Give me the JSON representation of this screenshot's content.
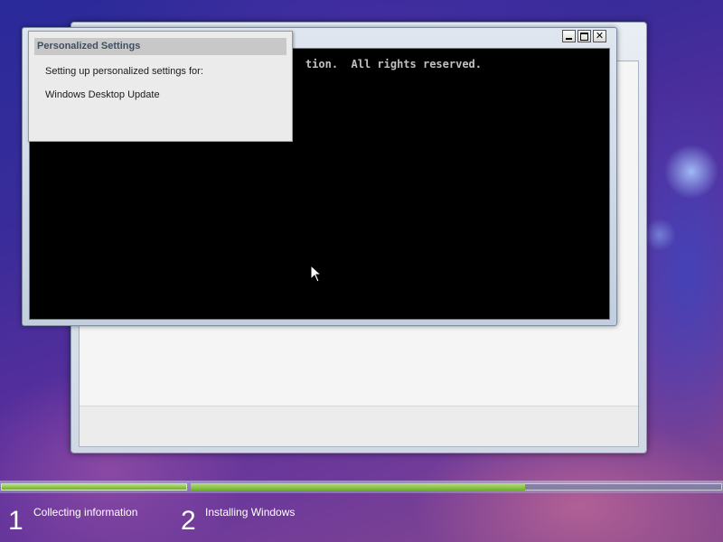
{
  "dialog": {
    "title": "Personalized Settings",
    "line1": "Setting up personalized settings for:",
    "line2": "Windows Desktop Update"
  },
  "console": {
    "visible_text": "tion.  All rights reserved."
  },
  "window_controls": {
    "minimize": "minimize-icon",
    "maximize": "maximize-icon",
    "close": "close-icon",
    "close_glyph": "✕"
  },
  "setup_progress": {
    "steps": [
      {
        "number": "1",
        "label": "Collecting information",
        "progress": 1.0
      },
      {
        "number": "2",
        "label": "Installing Windows",
        "progress": 0.63
      }
    ],
    "colors": {
      "fill": "#8cc63f",
      "track": "#7a86a8"
    }
  }
}
